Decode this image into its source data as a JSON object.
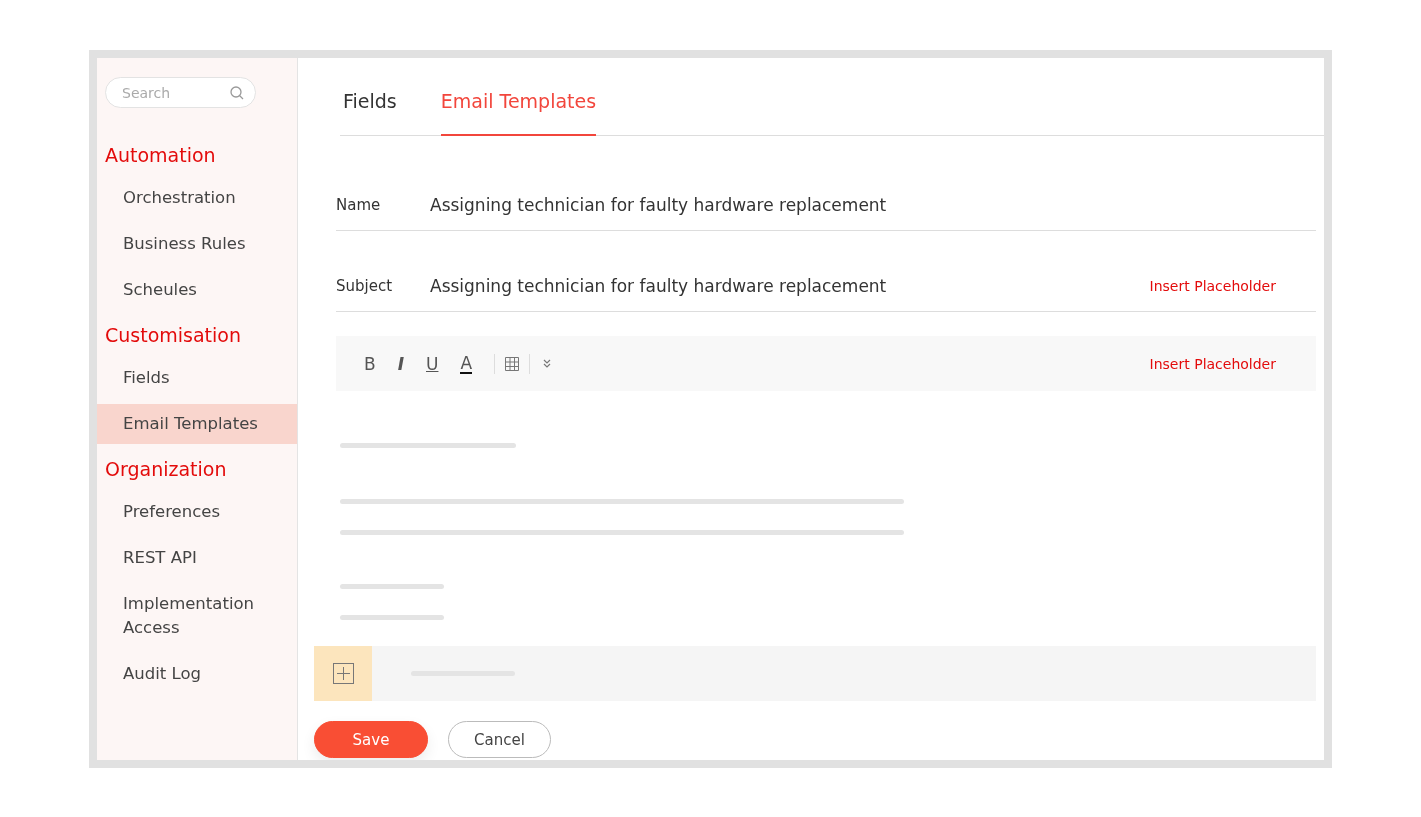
{
  "sidebar": {
    "search": {
      "placeholder": "Search"
    },
    "sections": [
      {
        "title": "Automation",
        "items": [
          {
            "label": "Orchestration",
            "selected": false
          },
          {
            "label": "Business Rules",
            "selected": false
          },
          {
            "label": "Scheules",
            "selected": false
          }
        ]
      },
      {
        "title": "Customisation",
        "items": [
          {
            "label": "Fields",
            "selected": false
          },
          {
            "label": "Email Templates",
            "selected": true
          }
        ]
      },
      {
        "title": "Organization",
        "items": [
          {
            "label": "Preferences",
            "selected": false
          },
          {
            "label": "REST API",
            "selected": false
          },
          {
            "label": "Implementation Access",
            "selected": false
          },
          {
            "label": "Audit Log",
            "selected": false
          }
        ]
      }
    ]
  },
  "tabs": [
    {
      "label": "Fields",
      "selected": false
    },
    {
      "label": "Email Templates",
      "selected": true
    }
  ],
  "form": {
    "fields": [
      {
        "label": "Name",
        "value": "Assigning technician for faulty hardware replacement"
      },
      {
        "label": "Subject",
        "value": "Assigning technician for faulty hardware replacement",
        "action": "Insert Placeholder"
      }
    ]
  },
  "editor": {
    "toolbar": [
      {
        "kind": "bold",
        "label": "B"
      },
      {
        "kind": "italic",
        "label": "I"
      },
      {
        "kind": "underline",
        "label": "U"
      },
      {
        "kind": "color",
        "label": "A"
      },
      {
        "kind": "table"
      },
      {
        "kind": "more"
      }
    ],
    "action": "Insert Placeholder"
  },
  "buttons": [
    {
      "kind": "primary",
      "label": "Save"
    },
    {
      "kind": "secondary",
      "label": "Cancel"
    }
  ]
}
